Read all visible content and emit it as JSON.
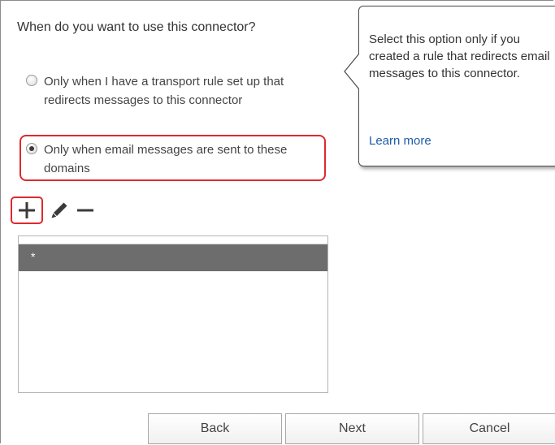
{
  "dialog": {
    "question": "When do you want to use this connector?",
    "options": [
      {
        "label": "Only when I have a transport rule set up that redirects messages to this connector",
        "selected": false
      },
      {
        "label": "Only when email messages are sent to these domains",
        "selected": true
      }
    ]
  },
  "toolbar": {
    "add_icon": "plus-icon",
    "edit_icon": "pencil-icon",
    "remove_icon": "minus-icon"
  },
  "domain_list": {
    "items": [
      "*"
    ]
  },
  "buttons": {
    "back": "Back",
    "next": "Next",
    "cancel": "Cancel"
  },
  "tooltip": {
    "text": "Select this option only if you created a rule that redirects email messages to this connector.",
    "link": "Learn more"
  },
  "colors": {
    "highlight": "#e0282e",
    "selected_row": "#6d6d6d",
    "link": "#1e5ba6"
  }
}
